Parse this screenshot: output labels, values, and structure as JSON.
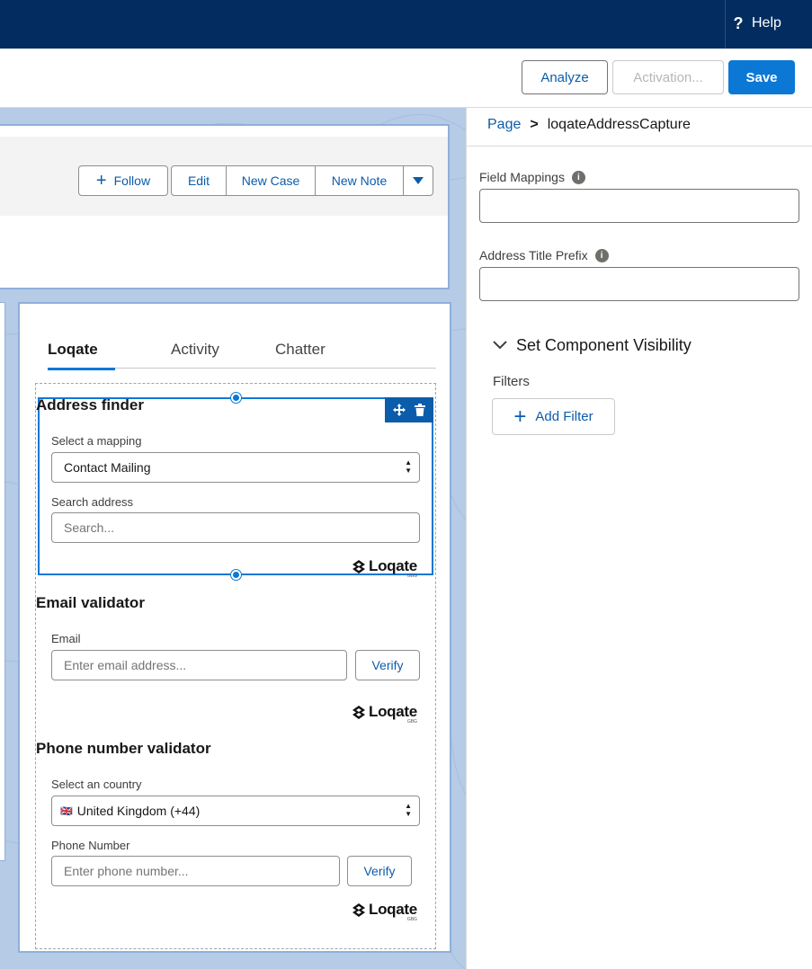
{
  "topbar": {
    "help_label": "Help",
    "help_icon": "question-icon"
  },
  "toolbar": {
    "analyze_label": "Analyze",
    "activation_label": "Activation...",
    "save_label": "Save"
  },
  "record_header": {
    "follow_label": "Follow",
    "actions": [
      "Edit",
      "New Case",
      "New Note"
    ]
  },
  "component": {
    "tabs": [
      {
        "label": "Loqate",
        "active": true
      },
      {
        "label": "Activity",
        "active": false
      },
      {
        "label": "Chatter",
        "active": false
      }
    ],
    "address_finder": {
      "title": "Address finder",
      "mapping_label": "Select a mapping",
      "mapping_value": "Contact Mailing",
      "search_label": "Search address",
      "search_placeholder": "Search..."
    },
    "email_validator": {
      "title": "Email validator",
      "email_label": "Email",
      "email_placeholder": "Enter email address...",
      "verify_label": "Verify"
    },
    "phone_validator": {
      "title": "Phone number validator",
      "country_label": "Select an country",
      "country_flag": "🇬🇧",
      "country_value": "United Kingdom (+44)",
      "phone_label": "Phone Number",
      "phone_placeholder": "Enter phone number...",
      "verify_label": "Verify"
    },
    "logo": {
      "text": "Loqate",
      "sub": "GBG"
    }
  },
  "properties": {
    "breadcrumb": {
      "root": "Page",
      "separator": ">",
      "current": "loqateAddressCapture"
    },
    "field_mappings_label": "Field Mappings",
    "address_title_prefix_label": "Address Title Prefix",
    "visibility_title": "Set Component Visibility",
    "filters_label": "Filters",
    "add_filter_label": "Add Filter"
  },
  "colors": {
    "topbar": "#032d60",
    "brand_blue": "#0b78d5",
    "link_blue": "#0b5cab",
    "canvas_bg": "#b5cbe6"
  }
}
